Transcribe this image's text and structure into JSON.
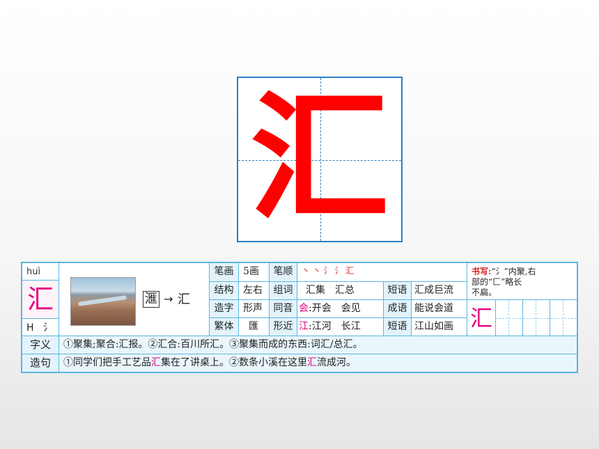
{
  "main_char": "汇",
  "card": {
    "pinyin": "huì",
    "char": "汇",
    "radical": "H",
    "radical_char": "氵",
    "ancient_char": "滙",
    "arrow": "→",
    "modern_char": "汇",
    "rows": [
      {
        "label1": "笔画",
        "value1": "5画",
        "label2": "笔顺",
        "value2": "丶 丶 氵 氵 汇"
      },
      {
        "label1": "结构",
        "value1": "左右",
        "label2": "组词",
        "value2": "汇集　汇总",
        "label3": "短语",
        "value3": "汇成巨流"
      },
      {
        "label1": "造字",
        "value1": "形声",
        "label2": "同音",
        "value2_hl": "会",
        "value2": ":开会　会见",
        "label3": "成语",
        "value3": "能说会道"
      },
      {
        "label1": "繁体",
        "value1": "匯",
        "label2": "形近",
        "value2_hl": "江",
        "value2": ":江河　长江",
        "label3": "短语",
        "value3": "江山如画"
      }
    ],
    "writing": {
      "label": "书写:",
      "text1": "“氵”内聚,右",
      "text2": "部的“匚”略长",
      "text3": "不扁。",
      "sample_char": "汇"
    },
    "meaning": {
      "label": "字义",
      "text": "①聚集;聚合:汇报。②汇合:百川所汇。③聚集而成的东西:词汇/总汇。"
    },
    "sentence": {
      "label": "造句",
      "part1": "①同学们把手工艺品",
      "hl1": "汇",
      "part2": "集在了讲桌上。②数条小溪在这里",
      "hl2": "汇",
      "part3": "流成河。"
    }
  }
}
